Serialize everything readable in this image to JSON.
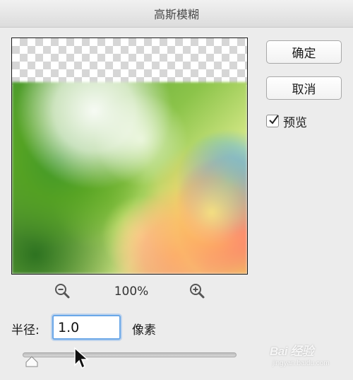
{
  "window": {
    "title": "高斯模糊"
  },
  "buttons": {
    "ok_label": "确定",
    "cancel_label": "取消"
  },
  "preview_toggle": {
    "label": "预览",
    "checked": true
  },
  "zoom": {
    "level": "100%",
    "zoom_out_icon": "zoom-out-magnifier",
    "zoom_in_icon": "zoom-in-magnifier"
  },
  "radius": {
    "label": "半径:",
    "value": "1.0",
    "unit": "像素"
  },
  "slider": {
    "value": 1.0
  },
  "watermark": {
    "logo": "Bai 经验",
    "url": "jingyan.baidu.com"
  },
  "colors": {
    "dialog_bg": "#ececec",
    "focus_ring": "#6aa7e8"
  }
}
